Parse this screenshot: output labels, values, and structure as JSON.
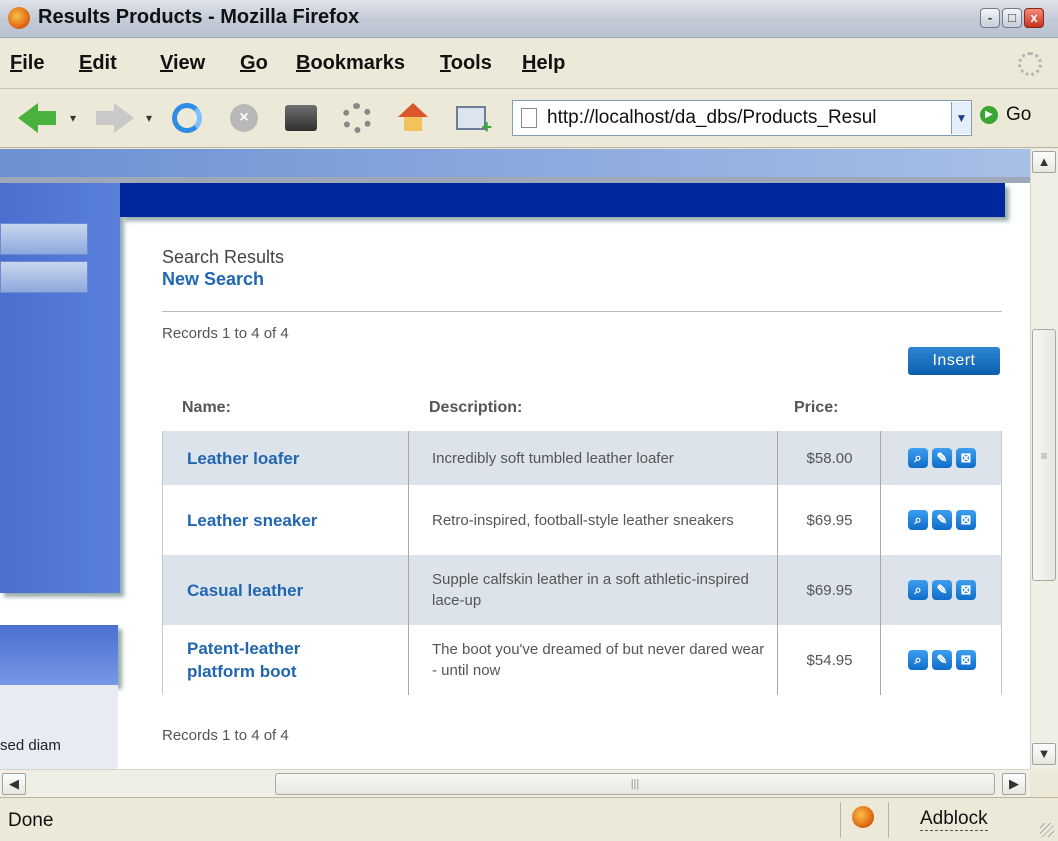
{
  "window": {
    "title": "Results Products - Mozilla Firefox",
    "controls": {
      "minimize": "-",
      "maximize": "□",
      "close": "x"
    }
  },
  "menu": [
    {
      "label": "File",
      "accel": "F",
      "rest": "ile"
    },
    {
      "label": "Edit",
      "accel": "E",
      "rest": "dit"
    },
    {
      "label": "View",
      "accel": "V",
      "rest": "iew"
    },
    {
      "label": "Go",
      "accel": "G",
      "rest": "o"
    },
    {
      "label": "Bookmarks",
      "accel": "B",
      "rest": "ookmarks"
    },
    {
      "label": "Tools",
      "accel": "T",
      "rest": "ools"
    },
    {
      "label": "Help",
      "accel": "H",
      "rest": "elp"
    }
  ],
  "toolbar": {
    "icons": [
      "back-icon",
      "forward-icon",
      "reload-icon",
      "stop-icon",
      "print-icon",
      "settings-icon",
      "home-icon",
      "new-window-icon"
    ],
    "url": "http://localhost/da_dbs/Products_Resul",
    "go_label": "Go"
  },
  "sidebar": {
    "clipped_text": "sed diam"
  },
  "main": {
    "section_title": "Search Results",
    "new_search_link": "New Search",
    "records_top": "Records 1 to 4 of 4",
    "insert_label": "Insert",
    "columns": {
      "name": "Name:",
      "description": "Description:",
      "price": "Price:"
    },
    "rows": [
      {
        "name": "Leather loafer",
        "description": "Incredibly soft tumbled leather loafer",
        "price": "$58.00"
      },
      {
        "name": "Leather sneaker",
        "description": "Retro-inspired, football-style leather sneakers",
        "price": "$69.95"
      },
      {
        "name": "Casual leather",
        "description": "Supple calfskin leather in a soft athletic-inspired lace-up",
        "price": "$69.95"
      },
      {
        "name": "Patent-leather platform boot",
        "description": "The boot you've dreamed of but never dared wear - until now",
        "price": "$54.95"
      }
    ],
    "row_action_icons": [
      "view-icon",
      "edit-icon",
      "delete-icon"
    ],
    "records_bottom": "Records 1 to 4 of 4"
  },
  "status": {
    "text": "Done",
    "addon": "Adblock"
  },
  "colors": {
    "link": "#2166b0",
    "nav_dark": "#00279c",
    "sidebar_blue": "#4a6fcf",
    "alt_row": "#dde3ea",
    "button": "#0b5fae"
  }
}
